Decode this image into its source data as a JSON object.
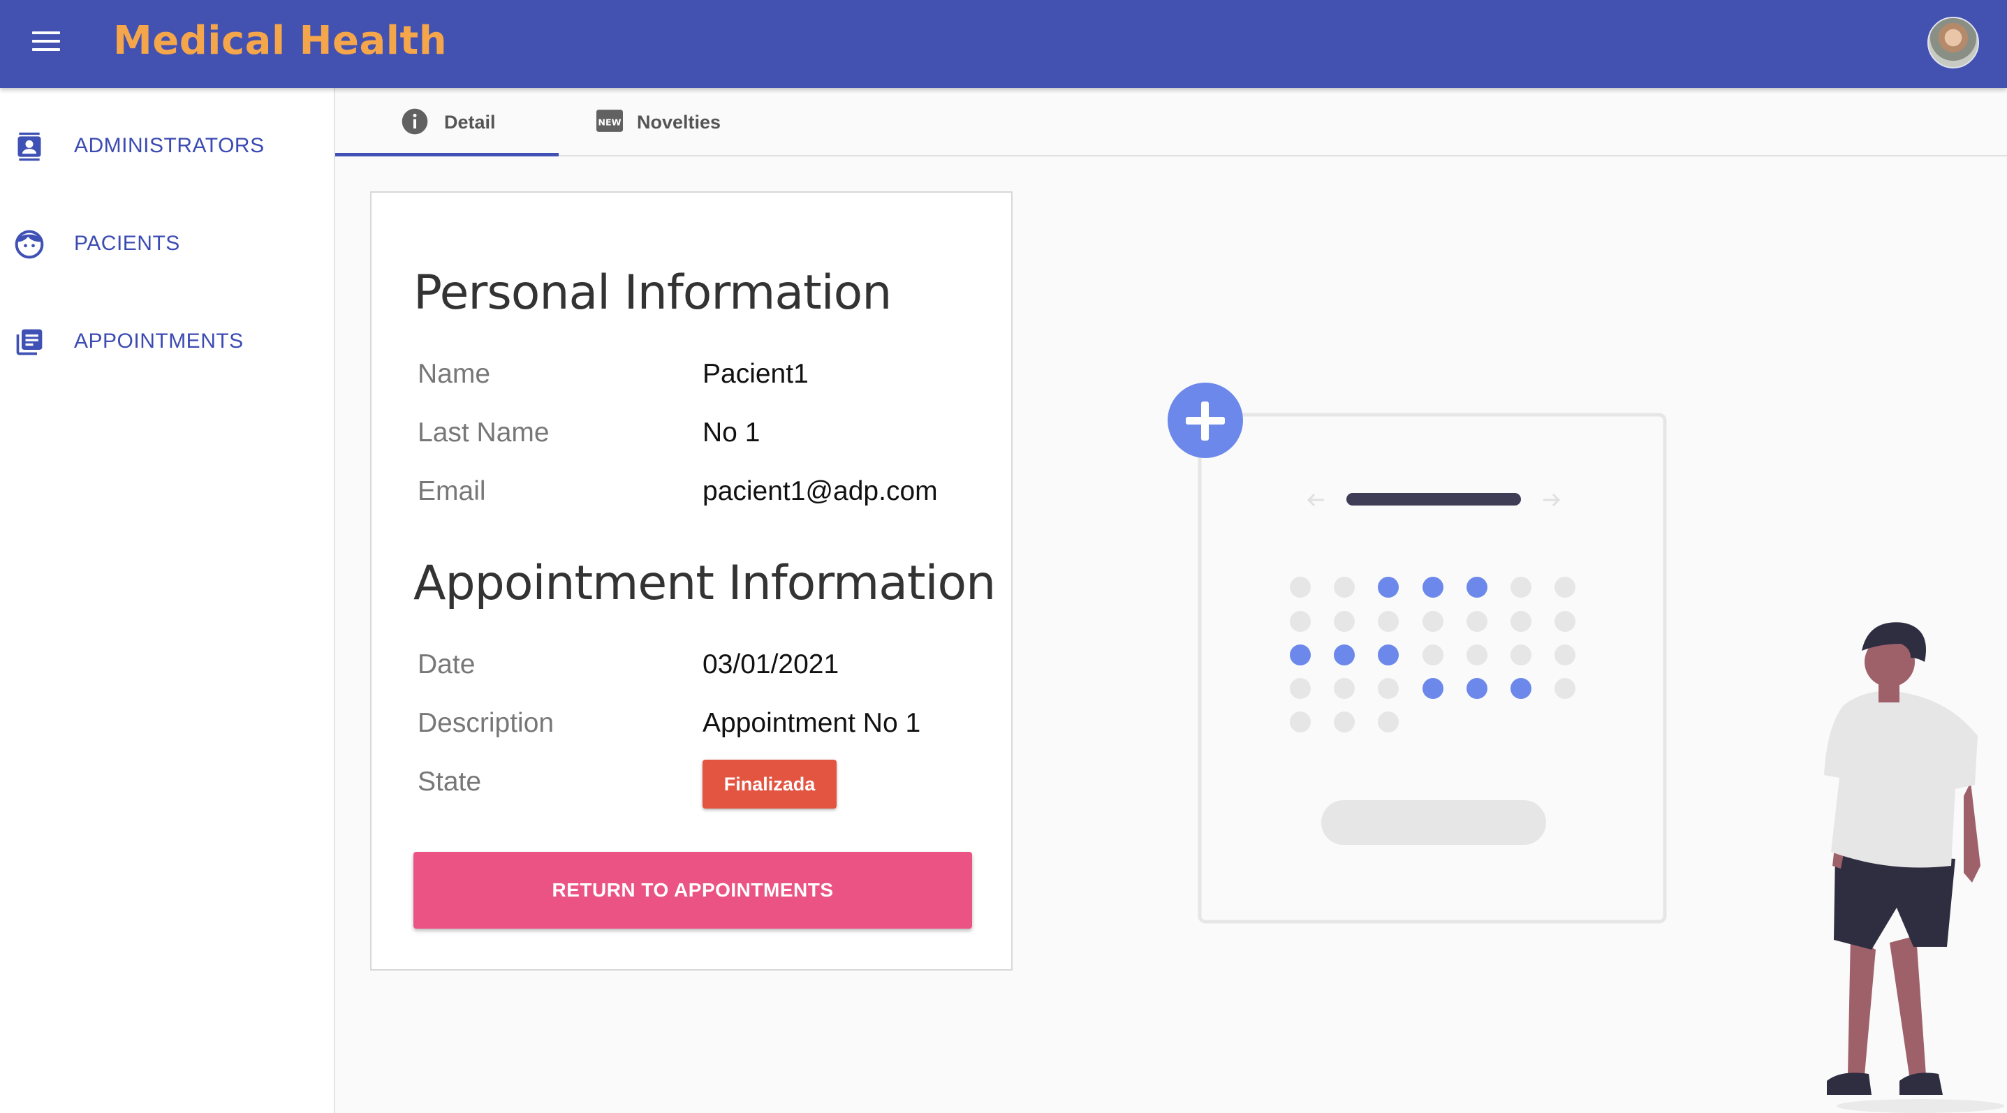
{
  "app": {
    "title": "Medical Health"
  },
  "colors": {
    "primary": "#4352b1",
    "title": "#f5a54a",
    "accent": "#ec5385",
    "state": "#e35441"
  },
  "header": {
    "menu_icon": "menu-icon",
    "avatar_icon": "avatar"
  },
  "sidebar": {
    "items": [
      {
        "label": "ADMINISTRATORS",
        "icon": "contact-card-icon"
      },
      {
        "label": "PACIENTS",
        "icon": "face-icon"
      },
      {
        "label": "APPOINTMENTS",
        "icon": "library-books-icon"
      }
    ]
  },
  "tabs": [
    {
      "label": "Detail",
      "icon": "info-icon",
      "active": true
    },
    {
      "label": "Novelties",
      "icon": "new-releases-icon",
      "active": false
    }
  ],
  "personal": {
    "title": "Personal Information",
    "fields": [
      {
        "label": "Name",
        "value": "Pacient1"
      },
      {
        "label": "Last Name",
        "value": "No 1"
      },
      {
        "label": "Email",
        "value": "pacient1@adp.com"
      }
    ]
  },
  "appointment": {
    "title": "Appointment Information",
    "fields": [
      {
        "label": "Date",
        "value": "03/01/2021"
      },
      {
        "label": "Description",
        "value": "Appointment No 1"
      },
      {
        "label": "State",
        "value": "Finalizada"
      }
    ]
  },
  "actions": {
    "return_label": "RETURN TO APPOINTMENTS"
  }
}
